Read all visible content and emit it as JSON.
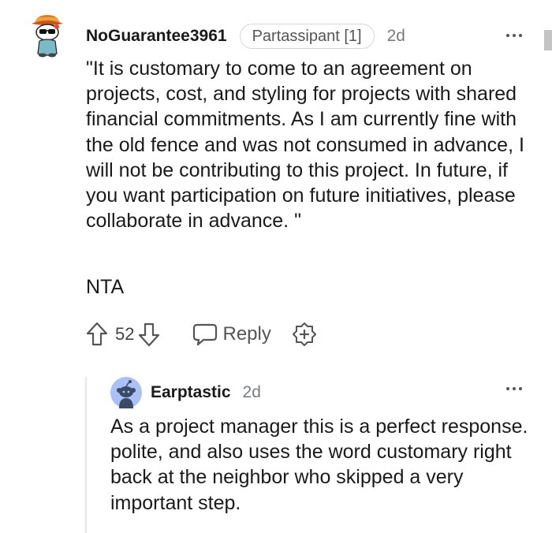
{
  "comment": {
    "username": "NoGuarantee3961",
    "flair": "Partassipant [1]",
    "age": "2d",
    "body": "\"It is customary to come to an agreement on projects, cost, and styling for projects with shared financial commitments. As I am currently fine with the old fence and was not consumed in advance, I will not be contributing to this project. In future, if you want participation on future initiatives, please collaborate in advance. \"",
    "verdict": "NTA",
    "score": "52",
    "reply_label": "Reply",
    "icons": {
      "avatar": "snoo-avatar-with-hat-icon",
      "upvote": "upvote-arrow-icon",
      "downvote": "downvote-arrow-icon",
      "reply": "speech-bubble-icon",
      "award": "award-plus-icon",
      "more": "more-options-icon"
    }
  },
  "reply": {
    "username": "Earptastic",
    "age": "2d",
    "body": "As a project manager this is a perfect response. polite, and also uses the word customary right back at the neighbor who skipped a very important step.",
    "icons": {
      "avatar": "default-snoo-avatar-icon",
      "more": "more-options-icon"
    }
  },
  "colors": {
    "text": "#1a1a1b",
    "meta": "#787c7e",
    "flair_border": "#d6d6d6",
    "avatar_bg": "#a9c1f5",
    "thread_line": "#e6e6e6"
  }
}
